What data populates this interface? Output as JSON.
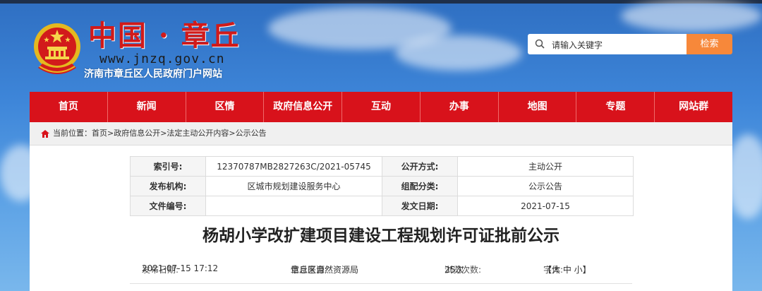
{
  "header": {
    "logo_title": "中国 · 章丘",
    "logo_url": "www.jnzq.gov.cn",
    "logo_subtitle": "济南市章丘区人民政府门户网站"
  },
  "search": {
    "placeholder": "请输入关键字",
    "button_label": "检索"
  },
  "nav": {
    "items": [
      "首页",
      "新闻",
      "区情",
      "政府信息公开",
      "互动",
      "办事",
      "地图",
      "专题",
      "网站群"
    ]
  },
  "breadcrumb": {
    "label": "当前位置：",
    "path": "首页>政府信息公开>法定主动公开内容>公示公告"
  },
  "info_table": {
    "index_label": "索引号:",
    "index_value": "12370787MB2827263C/2021-05745",
    "open_mode_label": "公开方式:",
    "open_mode_value": "主动公开",
    "publisher_label": "发布机构:",
    "publisher_value": "区城市规划建设服务中心",
    "category_label": "组配分类:",
    "category_value": "公示公告",
    "doc_no_label": "文件编号:",
    "doc_no_value": "",
    "date_label": "发文日期:",
    "date_value": "2021-07-15"
  },
  "article": {
    "title": "杨胡小学改扩建项目建设工程规划许可证批前公示",
    "publish_label": "发布日期:",
    "publish_value": "2021-07-15 17:12",
    "source_label": "信息来源:",
    "source_value": "章丘区自然资源局",
    "views_label": "浏览次数:",
    "views_value": "25次",
    "font_label": "字体:",
    "font_sizes": "【大 中 小】"
  },
  "colors": {
    "nav_red": "#d8121b",
    "search_orange": "#f7883a",
    "logo_red": "#d11a1a"
  }
}
